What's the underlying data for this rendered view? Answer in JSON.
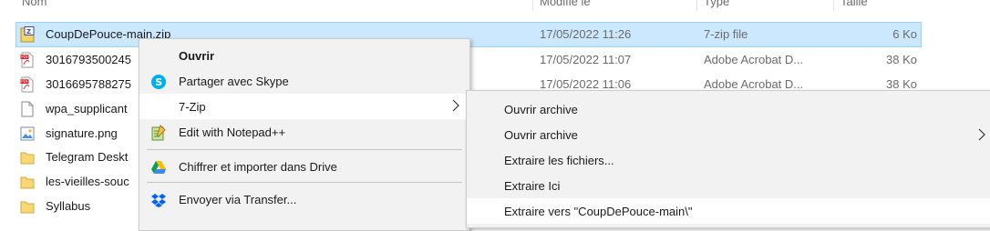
{
  "columns": {
    "name": "Nom",
    "modified": "Modifié le",
    "type": "Type",
    "size": "Taille"
  },
  "files": [
    {
      "name": "CoupDePouce-main.zip",
      "date": "17/05/2022 11:26",
      "type": "7-zip file",
      "size": "6 Ko",
      "icon": "zip-icon",
      "selected": true
    },
    {
      "name": "3016793500245",
      "date": "17/05/2022 11:07",
      "type": "Adobe Acrobat D...",
      "size": "38 Ko",
      "icon": "pdf-icon"
    },
    {
      "name": "3016695788275",
      "date": "17/05/2022 11:06",
      "type": "Adobe Acrobat D...",
      "size": "38 Ko",
      "icon": "pdf-icon"
    },
    {
      "name": "wpa_supplicant",
      "icon": "document-icon"
    },
    {
      "name": "signature.png",
      "icon": "image-icon"
    },
    {
      "name": "Telegram Deskt",
      "icon": "folder-icon"
    },
    {
      "name": "les-vieilles-souc",
      "icon": "folder-icon"
    },
    {
      "name": "Syllabus",
      "icon": "folder-icon"
    }
  ],
  "context_menu": {
    "items": [
      {
        "label": "Ouvrir",
        "bold": true
      },
      {
        "label": "Partager avec Skype",
        "icon": "skype-icon"
      },
      {
        "label": "7-Zip",
        "has_submenu": true,
        "highlighted": true
      },
      {
        "label": "Edit with Notepad++",
        "icon": "notepadpp-icon"
      },
      {
        "label": "Chiffrer et importer dans Drive",
        "icon": "google-drive-icon"
      },
      {
        "label": "Envoyer via Transfer...",
        "icon": "dropbox-icon"
      }
    ]
  },
  "submenu_7zip": {
    "items": [
      {
        "label": "Ouvrir archive"
      },
      {
        "label": "Ouvrir archive",
        "has_submenu": true
      },
      {
        "label": "Extraire les fichiers..."
      },
      {
        "label": "Extraire Ici"
      },
      {
        "label": "Extraire vers \"CoupDePouce-main\\\"",
        "highlighted": true
      }
    ]
  },
  "colors": {
    "selection_bg": "#cce8ff",
    "selection_border": "#99d1ff",
    "menu_bg": "#f2f2f2",
    "menu_hover": "#ffffff"
  }
}
